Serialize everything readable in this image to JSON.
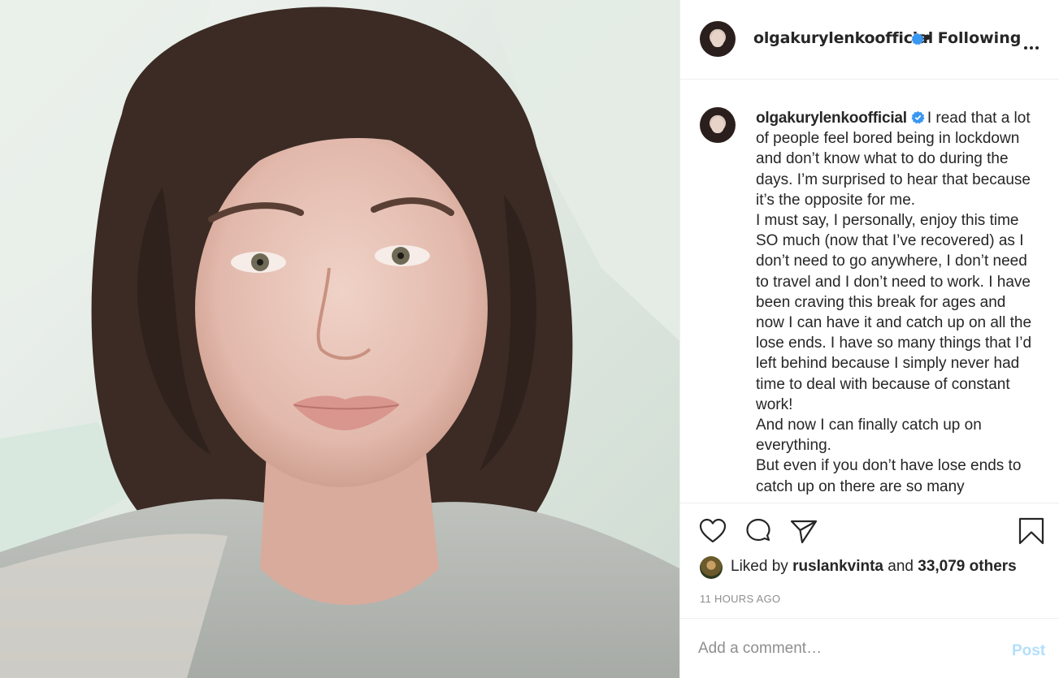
{
  "post": {
    "username": "olgakurylenkoofficial",
    "follow_status": "Following",
    "separator": "•",
    "caption_paragraphs": [
      "I read that a lot of people feel bored being in lockdown and don’t know what to do during the days. I’m surprised to hear that because it’s the opposite for me.",
      "I must say, I personally, enjoy this time SO much (now that I’ve recovered) as I don’t need to go anywhere, I don’t need to travel and I don’t need to work. I have been craving this break for ages and now I can have it and catch up on all the lose ends. I have so many things that I’d left behind because I simply never had time to deal with because of constant work!",
      "And now I can finally catch up on everything.",
      "But even if you don’t have lose ends to catch up on there are so many"
    ],
    "likes": {
      "prefix": "Liked by",
      "liker": "ruslankvinta",
      "conjunction": "and",
      "others": "33,079 others"
    },
    "timestamp": "11 HOURS AGO"
  },
  "comment": {
    "placeholder": "Add a comment…",
    "post_label": "Post"
  },
  "icons": {
    "verified": "verified-badge-icon",
    "more": "more-options-icon",
    "like": "heart-icon",
    "comment": "comment-bubble-icon",
    "share": "paper-plane-icon",
    "save": "bookmark-icon"
  },
  "colors": {
    "verified_blue": "#3897f0",
    "post_button": "#b2dffc",
    "muted_text": "#8e8e8e"
  }
}
